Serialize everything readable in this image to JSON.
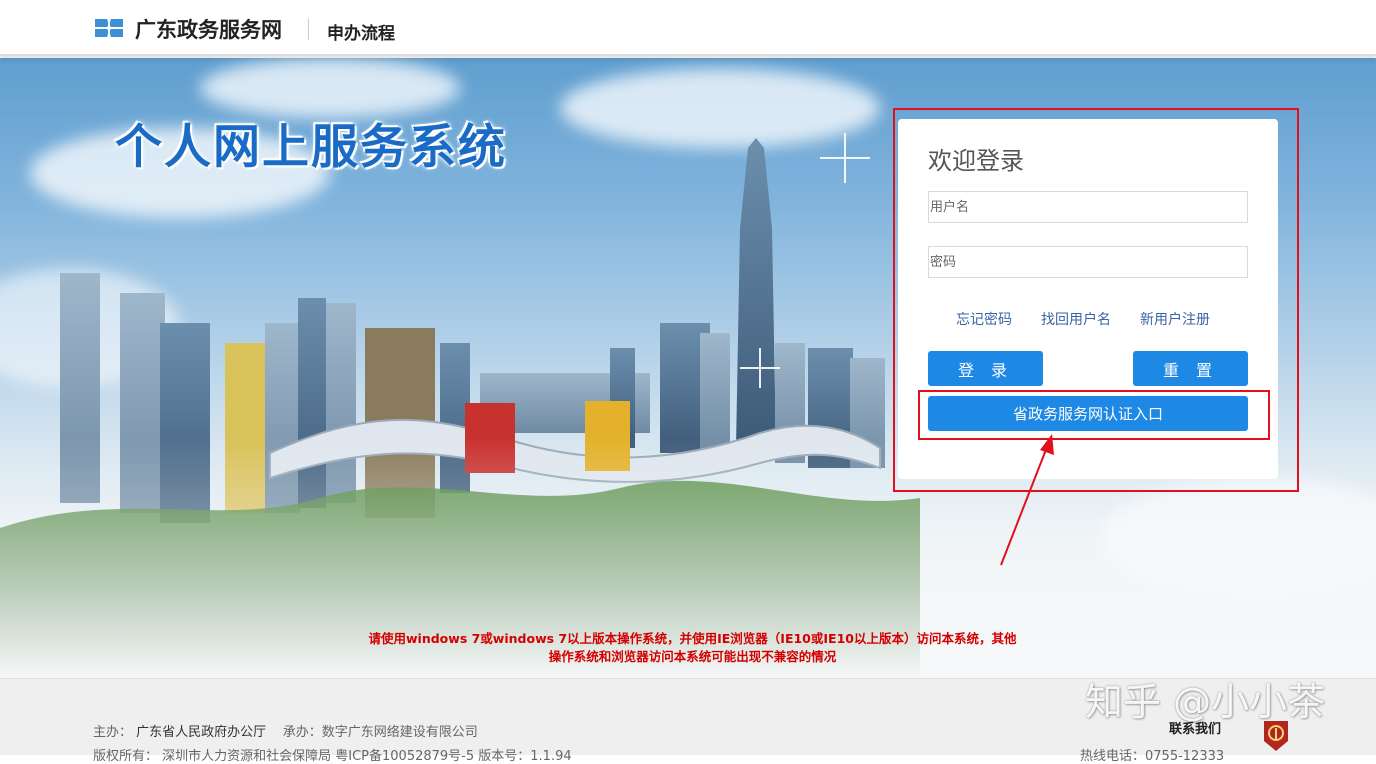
{
  "header": {
    "site_name": "广东政务服务网",
    "section": "申办流程"
  },
  "hero": {
    "title": "个人网上服务系统"
  },
  "login": {
    "title": "欢迎登录",
    "username_placeholder": "用户名",
    "password_placeholder": "密码",
    "links": [
      "忘记密码",
      "找回用户名",
      "新用户注册"
    ],
    "login_button": "登 录",
    "reset_button": "重 置",
    "cert_button": "省政务服务网认证入口"
  },
  "notice": {
    "line1": "请使用windows 7或windows 7以上版本操作系统，并使用IE浏览器（IE10或IE10以上版本）访问本系统，其他",
    "line2": "操作系统和浏览器访问本系统可能出现不兼容的情况"
  },
  "footer": {
    "sponsor_label": "主办：",
    "sponsor": "广东省人民政府办公厅",
    "builder_label": "承办：",
    "builder": "数字广东网络建设有限公司",
    "copyright": "版权所有：  深圳市人力资源和社会保障局    粤ICP备10052879号-5    版本号：1.1.94",
    "contact": "联系我们",
    "hotline": "热线电话：0755-12333"
  },
  "watermark": "知乎 @小小茶",
  "colors": {
    "accent_blue": "#1e88e5",
    "highlight_red": "#e0101c",
    "notice_red": "#d40000",
    "title_blue": "#1a6bc6"
  }
}
